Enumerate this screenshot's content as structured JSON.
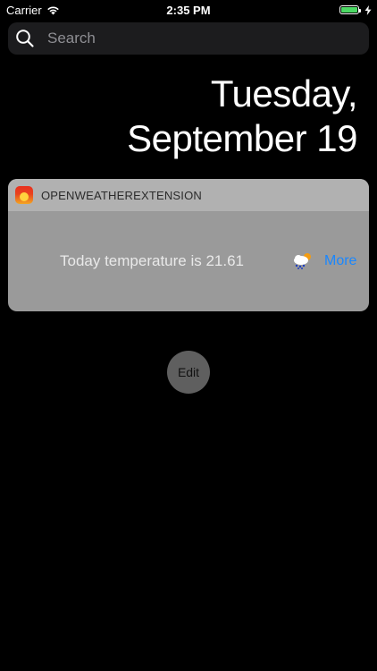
{
  "status_bar": {
    "carrier": "Carrier",
    "time": "2:35 PM",
    "battery_level": 1.0,
    "icons": [
      "wifi-icon",
      "battery-icon",
      "charging-icon"
    ]
  },
  "search": {
    "placeholder": "Search",
    "icon": "search-icon"
  },
  "date": {
    "weekday": "Tuesday,",
    "day": "September 19"
  },
  "widget": {
    "title": "OPENWEATHEREXTENSION",
    "app_icon": "sunset-app-icon",
    "temperature_text": "Today temperature is 21.61",
    "weather_icon": "cloud-rain-sun-icon",
    "more_label": "More"
  },
  "edit_label": "Edit",
  "colors": {
    "background": "#000000",
    "accent": "#1a87ff",
    "battery_green": "#4cd964"
  }
}
